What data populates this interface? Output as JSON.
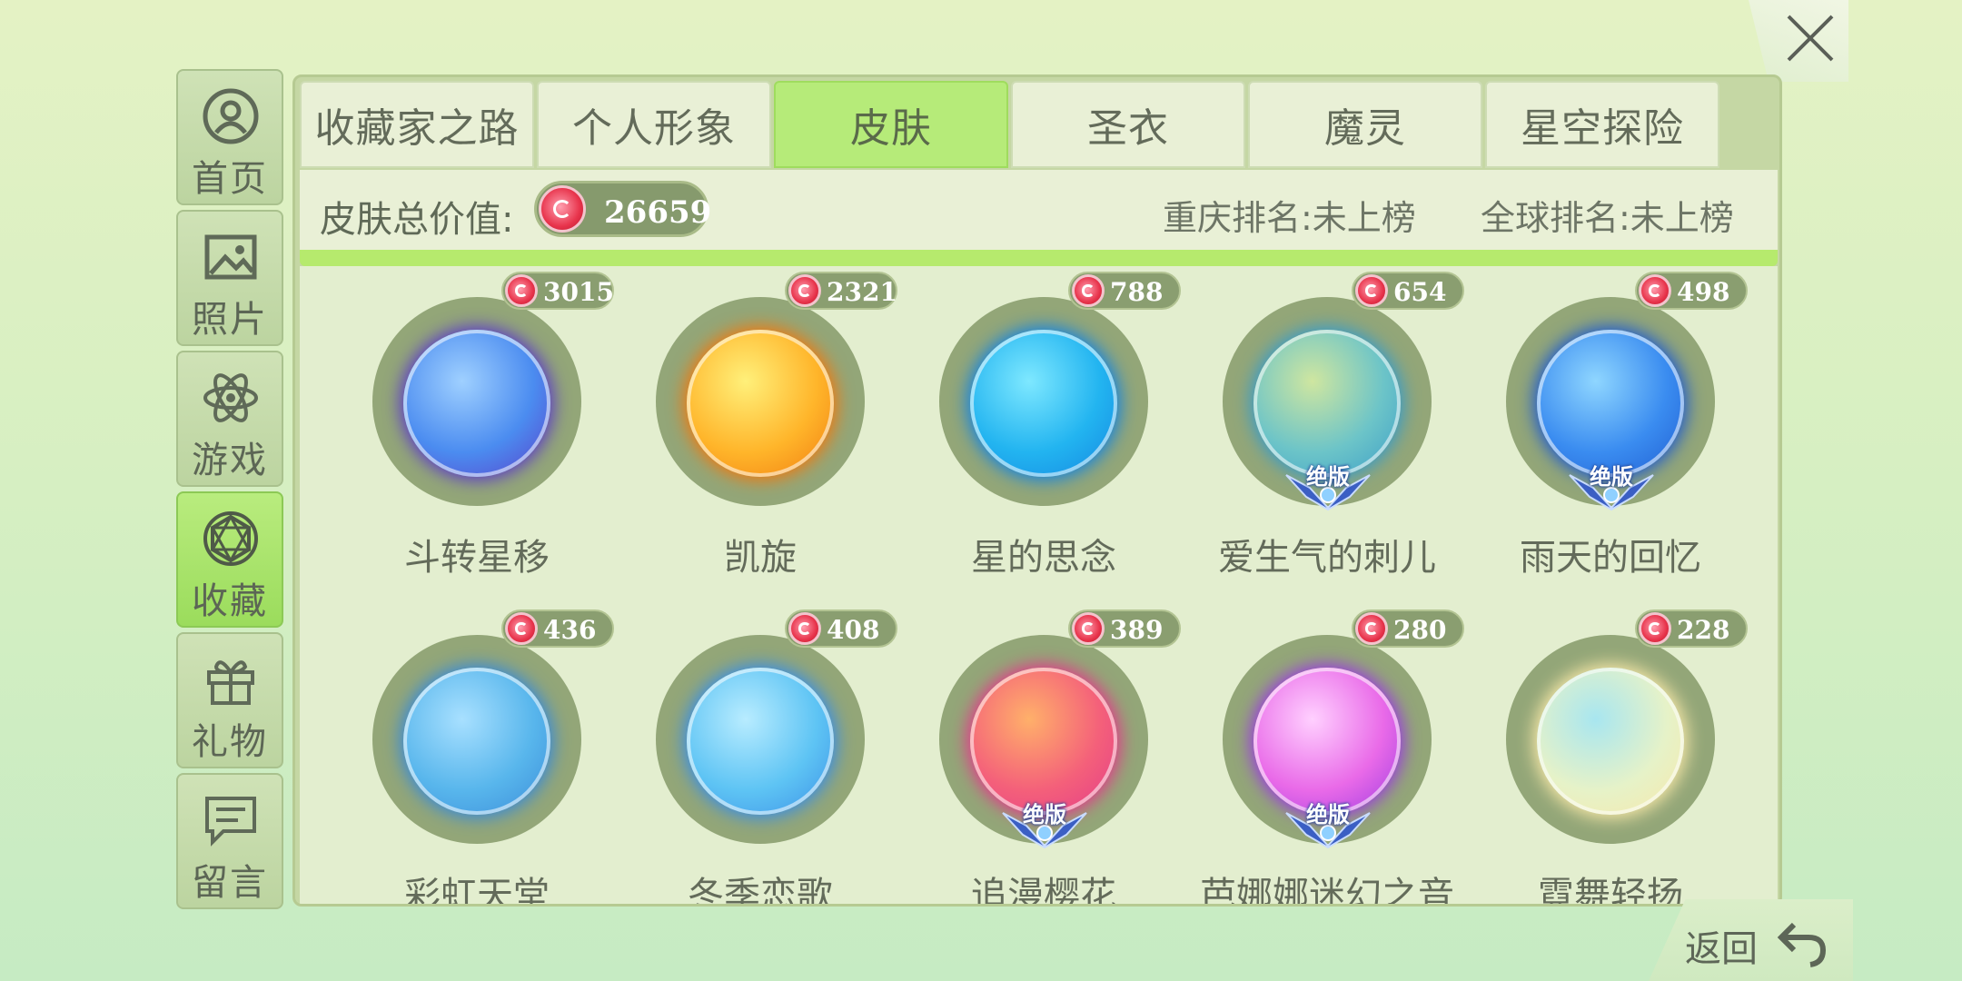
{
  "sidebar": {
    "items": [
      {
        "label": "首页",
        "icon": "user-icon",
        "active": false
      },
      {
        "label": "照片",
        "icon": "photo-icon",
        "active": false
      },
      {
        "label": "游戏",
        "icon": "atom-icon",
        "active": false
      },
      {
        "label": "收藏",
        "icon": "diamond-icon",
        "active": true
      },
      {
        "label": "礼物",
        "icon": "gift-icon",
        "active": false
      },
      {
        "label": "留言",
        "icon": "message-icon",
        "active": false
      }
    ]
  },
  "tabs": [
    {
      "label": "收藏家之路",
      "active": false
    },
    {
      "label": "个人形象",
      "active": false
    },
    {
      "label": "皮肤",
      "active": true
    },
    {
      "label": "圣衣",
      "active": false
    },
    {
      "label": "魔灵",
      "active": false
    },
    {
      "label": "星空探险",
      "active": false
    }
  ],
  "info": {
    "total_label": "皮肤总价值:",
    "total_value": "26659",
    "city_rank": "重庆排名:未上榜",
    "global_rank": "全球排名:未上榜"
  },
  "badge_text": "绝版",
  "skins": [
    {
      "name": "斗转星移",
      "price": "3015",
      "colors": [
        "#9fd0ff",
        "#4b8cf0",
        "#5b3cc8"
      ],
      "limited": false
    },
    {
      "name": "凯旋",
      "price": "2321",
      "colors": [
        "#fff07a",
        "#ffb52a",
        "#f07a10"
      ],
      "limited": false
    },
    {
      "name": "星的思念",
      "price": "788",
      "colors": [
        "#7ee8ff",
        "#22b4f0",
        "#1584e0"
      ],
      "limited": false
    },
    {
      "name": "爱生气的刺儿",
      "price": "654",
      "colors": [
        "#cfe6a0",
        "#6cc4c8",
        "#3a9cc8"
      ],
      "limited": true
    },
    {
      "name": "雨天的回忆",
      "price": "498",
      "colors": [
        "#8fd6ff",
        "#3a8cf0",
        "#1f5bd0"
      ],
      "limited": true
    },
    {
      "name": "彩虹天堂",
      "price": "436",
      "colors": [
        "#a8e0ff",
        "#58b6ec",
        "#3a8ad8"
      ],
      "limited": false
    },
    {
      "name": "冬季恋歌",
      "price": "408",
      "colors": [
        "#b8ecff",
        "#5ec4f4",
        "#3a8ee6"
      ],
      "limited": false
    },
    {
      "name": "追漫樱花",
      "price": "389",
      "colors": [
        "#ffb06a",
        "#f4607a",
        "#e23a8a"
      ],
      "limited": true
    },
    {
      "name": "芭娜娜迷幻之音",
      "price": "280",
      "colors": [
        "#ffd0ff",
        "#e96ae8",
        "#9a3ae0"
      ],
      "limited": true
    },
    {
      "name": "霓舞轻扬",
      "price": "228",
      "colors": [
        "#a8e6f0",
        "#e6f2c8",
        "#f8e8a8"
      ],
      "limited": false
    }
  ],
  "footer": {
    "return_label": "返回"
  }
}
